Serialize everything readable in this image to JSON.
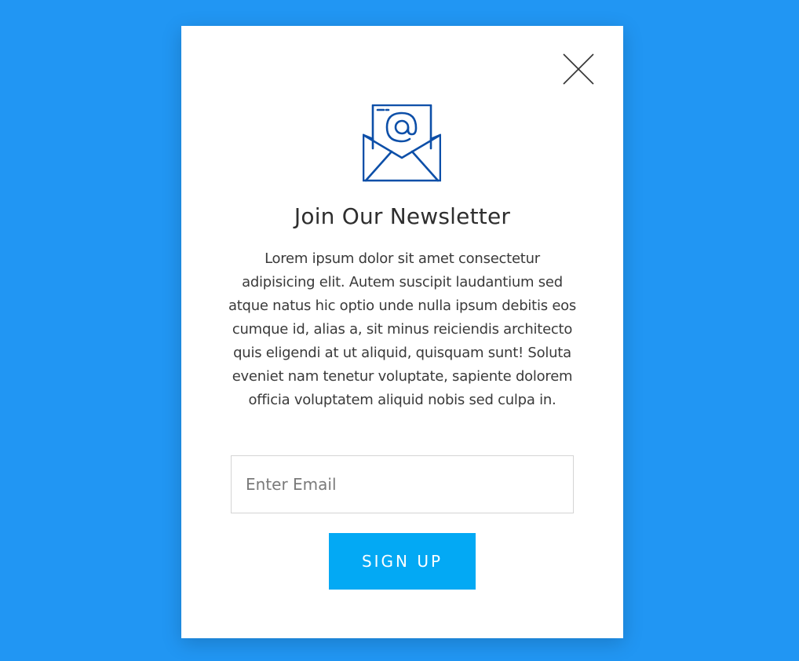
{
  "colors": {
    "background": "#2196f3",
    "modal": "#ffffff",
    "button": "#03a9f4",
    "icon": "#0d4fa8",
    "title": "#2e2e2e"
  },
  "modal": {
    "close_icon": "close-icon",
    "envelope_icon": "envelope-at-icon",
    "title": "Join Our Newsletter",
    "description": "Lorem ipsum dolor sit amet consectetur adipisicing elit. Autem suscipit laudantium sed atque natus hic optio unde nulla ipsum debitis eos cumque id, alias a, sit minus reiciendis architecto quis eligendi at ut aliquid, quisquam sunt! Soluta eveniet nam tenetur voluptate, sapiente dolorem officia voluptatem aliquid nobis sed culpa in.",
    "email": {
      "placeholder": "Enter Email",
      "value": ""
    },
    "signup_label": "SIGN UP"
  }
}
